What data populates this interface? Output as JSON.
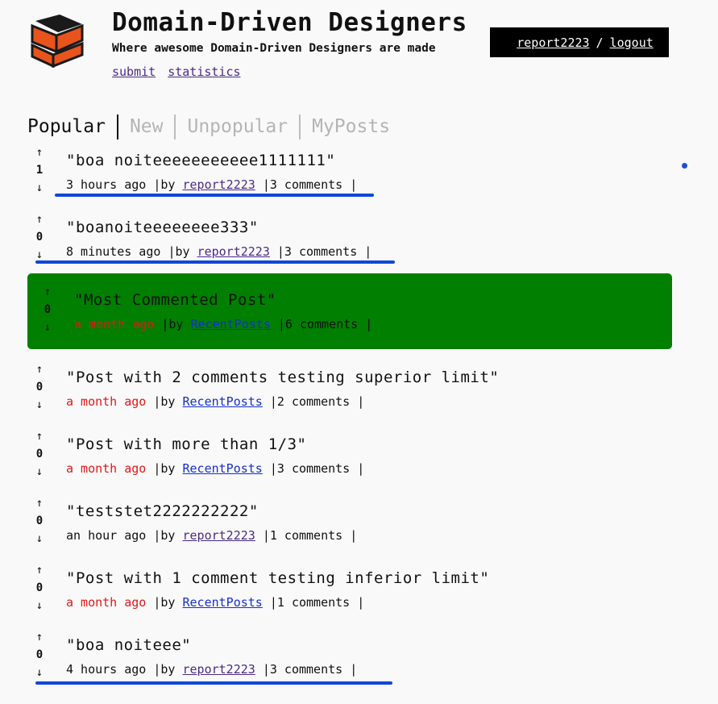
{
  "site": {
    "title": "Domain-Driven Designers",
    "tagline": "Where awesome Domain-Driven Designers are made",
    "links": [
      "submit",
      "statistics"
    ]
  },
  "user": {
    "name": "report2223",
    "separator": "/",
    "logout": "logout"
  },
  "tabs": [
    "Popular",
    "New",
    "Unpopular",
    "MyPosts"
  ],
  "posts": [
    {
      "up": "↑",
      "down": "↓",
      "score": "1",
      "title": "\"boa noiteeeeeeeeeee1111111\"",
      "time": "3 hours ago",
      "by": "|by",
      "author": "report2223",
      "comments": "|3 comments |",
      "old": false,
      "highlight": false,
      "self": true
    },
    {
      "up": "↑",
      "down": "↓",
      "score": "0",
      "title": "\"boanoiteeeeeeee333\"",
      "time": "8 minutes ago",
      "by": "|by",
      "author": "report2223",
      "comments": "|3 comments |",
      "old": false,
      "highlight": false,
      "self": true
    },
    {
      "up": "↑",
      "down": "↓",
      "score": "0",
      "title": "\"Most Commented Post\"",
      "time": "a month ago",
      "by": "|by",
      "author": "RecentPosts",
      "comments": "|6 comments |",
      "old": true,
      "highlight": true,
      "self": false
    },
    {
      "up": "↑",
      "down": "↓",
      "score": "0",
      "title": "\"Post with 2 comments testing superior limit\"",
      "time": "a month ago",
      "by": "|by",
      "author": "RecentPosts",
      "comments": "|2 comments |",
      "old": true,
      "highlight": false,
      "self": false
    },
    {
      "up": "↑",
      "down": "↓",
      "score": "0",
      "title": "\"Post with more than 1/3\"",
      "time": "a month ago",
      "by": "|by",
      "author": "RecentPosts",
      "comments": "|3 comments |",
      "old": true,
      "highlight": false,
      "self": false
    },
    {
      "up": "↑",
      "down": "↓",
      "score": "0",
      "title": "\"teststet2222222222\"",
      "time": "an hour ago",
      "by": "|by",
      "author": "report2223",
      "comments": "|1 comments |",
      "old": false,
      "highlight": false,
      "self": true
    },
    {
      "up": "↑",
      "down": "↓",
      "score": "0",
      "title": "\"Post with 1 comment testing inferior limit\"",
      "time": "a month ago",
      "by": "|by",
      "author": "RecentPosts",
      "comments": "|1 comments |",
      "old": true,
      "highlight": false,
      "self": false
    },
    {
      "up": "↑",
      "down": "↓",
      "score": "0",
      "title": "\"boa noiteee\"",
      "time": "4 hours ago",
      "by": "|by",
      "author": "report2223",
      "comments": "|3 comments |",
      "old": false,
      "highlight": false,
      "self": true
    }
  ],
  "colors": {
    "highlight": "#007f00",
    "old_time": "#e01818",
    "annotation": "#1047d8",
    "logo_orange": "#e8541c"
  },
  "icons": [
    "logo-bricks-icon",
    "upvote-arrow-icon",
    "downvote-arrow-icon",
    "indicator-dot-icon"
  ]
}
